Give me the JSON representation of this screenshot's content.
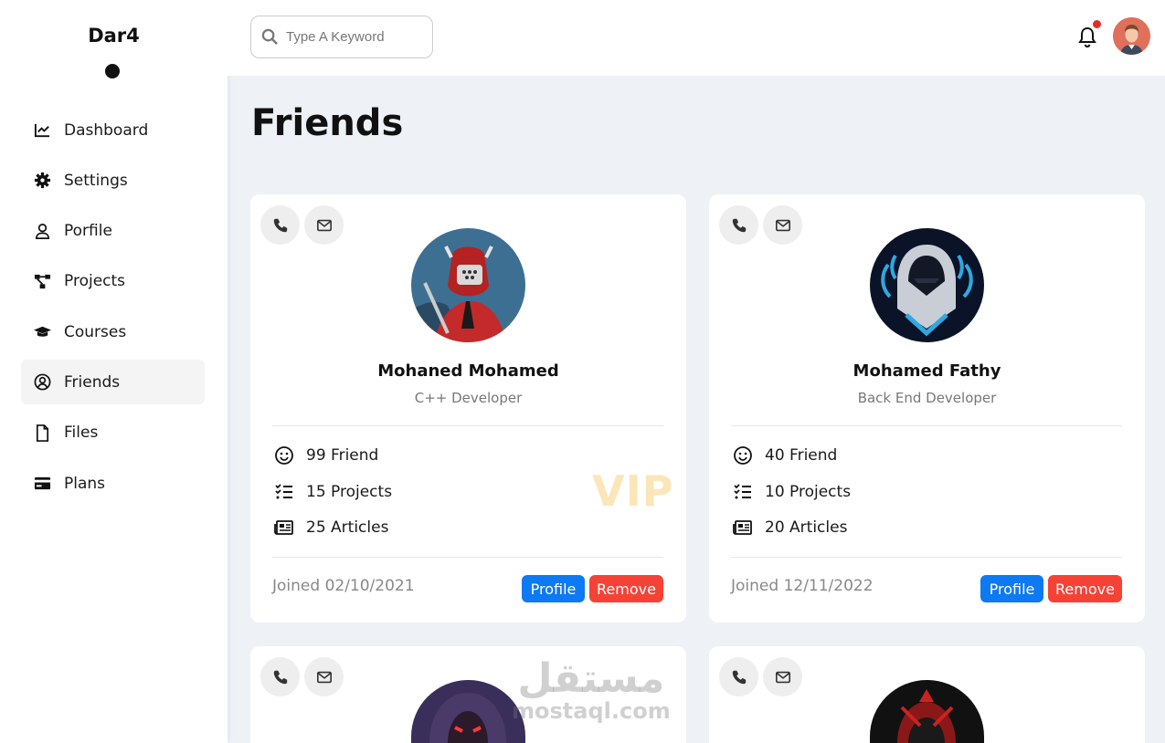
{
  "sidebar": {
    "brand": "Dar4",
    "items": [
      {
        "label": "Dashboard",
        "icon": "chart-line-icon"
      },
      {
        "label": "Settings",
        "icon": "gear-icon"
      },
      {
        "label": "Porfile",
        "icon": "user-icon"
      },
      {
        "label": "Projects",
        "icon": "diagram-project-icon"
      },
      {
        "label": "Courses",
        "icon": "graduation-cap-icon"
      },
      {
        "label": "Friends",
        "icon": "user-circle-icon",
        "active": true
      },
      {
        "label": "Files",
        "icon": "file-icon"
      },
      {
        "label": "Plans",
        "icon": "credit-card-icon"
      }
    ]
  },
  "header": {
    "search_placeholder": "Type A Keyword",
    "notification_icon": "bell-icon",
    "has_notification": true
  },
  "main": {
    "title": "Friends",
    "friends": [
      {
        "name": "Mohaned Mohamed",
        "role": "C++ Developer",
        "friends": "99 Friend",
        "projects": "15 Projects",
        "articles": "25 Articles",
        "badge": "VIP",
        "joined": "Joined 02/10/2021",
        "profile_label": "Profile",
        "remove_label": "Remove"
      },
      {
        "name": "Mohamed Fathy",
        "role": "Back End Developer",
        "friends": "40 Friend",
        "projects": "10 Projects",
        "articles": "20 Articles",
        "joined": "Joined 12/11/2022",
        "profile_label": "Profile",
        "remove_label": "Remove"
      }
    ]
  },
  "watermark": {
    "arabic": "مستقل",
    "latin": "mostaql.com"
  },
  "colors": {
    "primary": "#0d79f2",
    "danger": "#f44336",
    "badge": "#fbe6b8",
    "background": "#eef1f6"
  }
}
